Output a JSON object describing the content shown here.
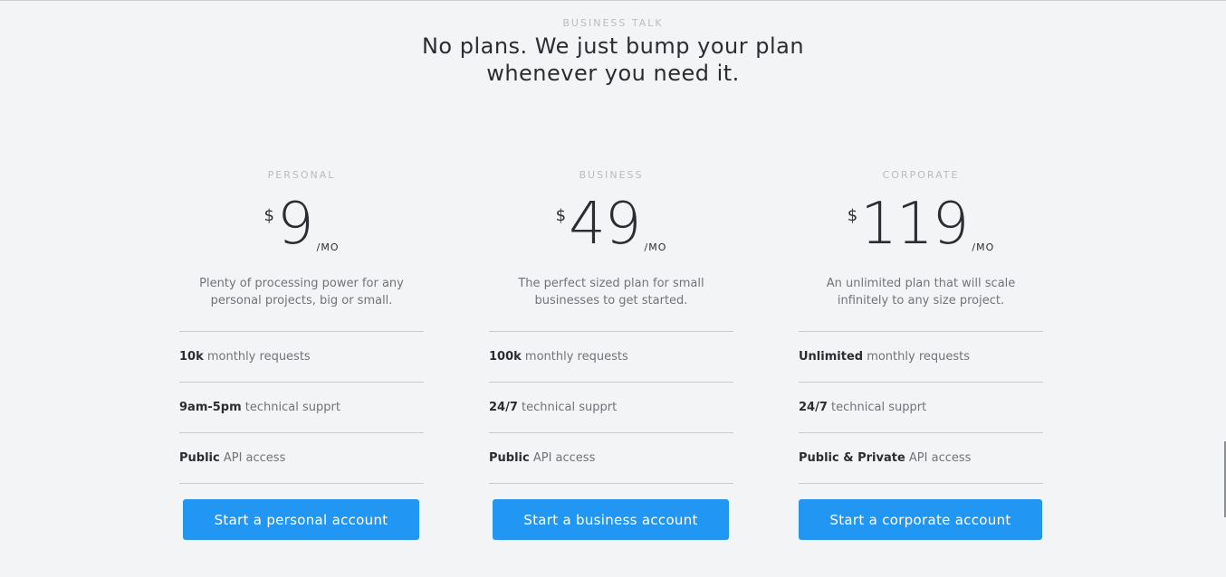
{
  "section": {
    "eyebrow": "BUSINESS TALK",
    "headline_line1": "No plans. We just bump your plan",
    "headline_line2": "whenever you need it."
  },
  "plans": [
    {
      "tier": "PERSONAL",
      "currency": "$",
      "amount": "9",
      "per": "/MO",
      "description": "Plenty of processing power for any personal projects, big or small.",
      "features": [
        {
          "strong": "10k",
          "rest": " monthly requests"
        },
        {
          "strong": "9am-5pm",
          "rest": " technical supprt"
        },
        {
          "strong": "Public",
          "rest": " API access"
        }
      ],
      "cta": "Start a personal account"
    },
    {
      "tier": "BUSINESS",
      "currency": "$",
      "amount": "49",
      "per": "/MO",
      "description": "The perfect sized plan for small businesses to get started.",
      "features": [
        {
          "strong": "100k",
          "rest": " monthly requests"
        },
        {
          "strong": "24/7",
          "rest": " technical supprt"
        },
        {
          "strong": "Public",
          "rest": " API access"
        }
      ],
      "cta": "Start a business account"
    },
    {
      "tier": "CORPORATE",
      "currency": "$",
      "amount": "119",
      "per": "/MO",
      "description": "An unlimited plan that will scale infinitely to any size project.",
      "features": [
        {
          "strong": "Unlimited",
          "rest": " monthly requests"
        },
        {
          "strong": "24/7",
          "rest": " technical supprt"
        },
        {
          "strong": "Public & Private",
          "rest": " API access"
        }
      ],
      "cta": "Start a corporate account"
    }
  ],
  "colors": {
    "background": "#f3f4f6",
    "accent": "#2196f3",
    "text": "#2a2d31",
    "muted": "#6f747a",
    "eyebrow": "#b8bcc1"
  }
}
